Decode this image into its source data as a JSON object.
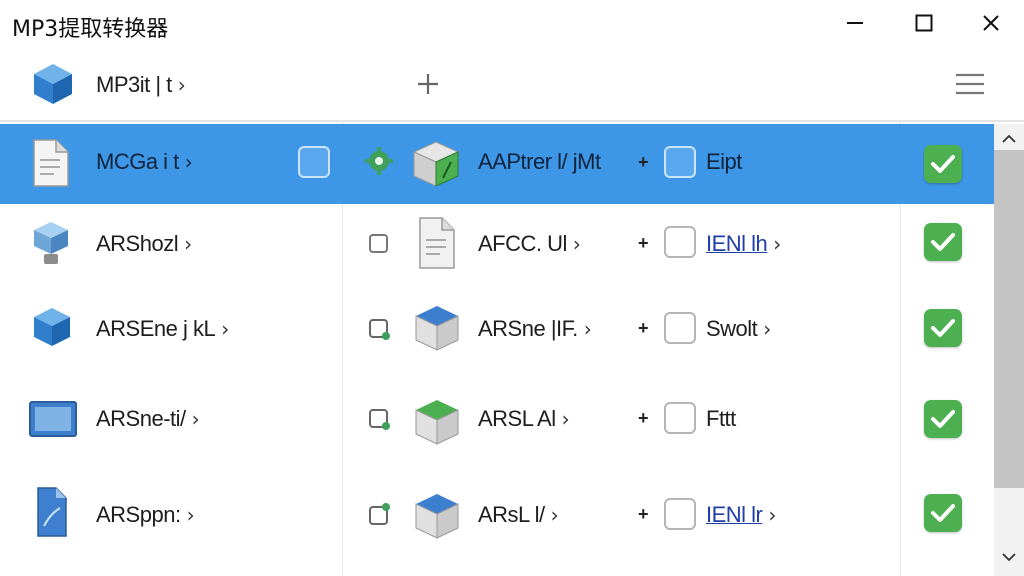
{
  "window": {
    "title": "MP3提取转换器",
    "minimize_icon": "minimize-icon",
    "maximize_icon": "maximize-icon",
    "close_icon": "close-icon"
  },
  "header": {
    "col1_label": "MP3it | t",
    "add_icon": "plus-icon",
    "menu_icon": "hamburger-menu-icon"
  },
  "rows": [
    {
      "name": "MCGa i t",
      "target": "AAPtrer l/ jMt",
      "output": "Eipt",
      "output_is_link": false,
      "selected": true
    },
    {
      "name": "ARShozl",
      "target": "AFCC. Ul",
      "output": "IENl lh",
      "output_is_link": true,
      "selected": false
    },
    {
      "name": "ARSEne j kL",
      "target": "ARSne |IF.",
      "output": "Swolt",
      "output_is_link": false,
      "selected": false
    },
    {
      "name": "ARSne-ti/",
      "target": "ARSL Al",
      "output": "Fttt",
      "output_is_link": false,
      "selected": false
    },
    {
      "name": "ARSppn:",
      "target": "ARsL l/",
      "output": "IENl lr",
      "output_is_link": true,
      "selected": false
    }
  ],
  "colors": {
    "selection": "#3d97e6",
    "status_green": "#4caf50",
    "link": "#1f3fa8"
  }
}
